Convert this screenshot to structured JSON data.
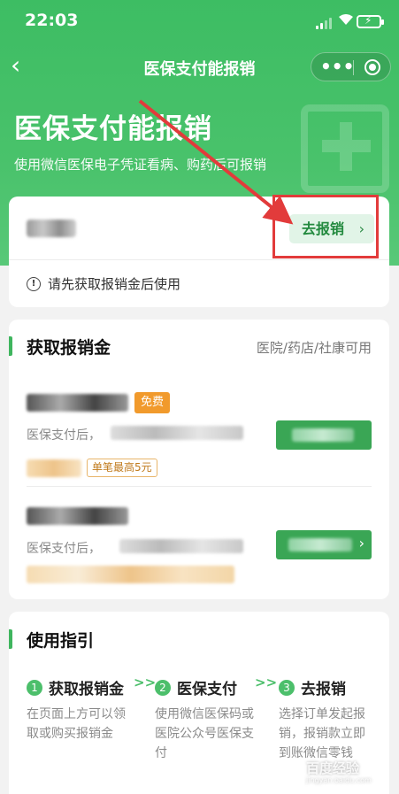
{
  "status_bar": {
    "time": "22:03"
  },
  "nav": {
    "title": "医保支付能报销",
    "more_icon": "•••"
  },
  "hero": {
    "title": "医保支付能报销",
    "subtitle": "使用微信医保电子凭证看病、购药后可报销"
  },
  "claim_card": {
    "button_label": "去报销",
    "notice": "请先获取报销金后使用"
  },
  "get_section": {
    "title": "获取报销金",
    "right_text": "医院/药店/社康可用",
    "items": [
      {
        "badge": "免费",
        "desc_visible": "医保支付后，",
        "limit_tag": "单笔最高5元"
      },
      {
        "desc_visible": "医保支付后，"
      }
    ]
  },
  "guide_section": {
    "title": "使用指引",
    "steps": [
      {
        "num": "1",
        "label": "获取报销金",
        "desc": "在页面上方可以领取或购买报销金"
      },
      {
        "num": "2",
        "label": "医保支付",
        "desc": "使用微信医保码或医院公众号医保支付"
      },
      {
        "num": "3",
        "label": "去报销",
        "desc": "选择订单发起报销，报销款立即到账微信零钱"
      }
    ],
    "arrow": ">>"
  },
  "watermark": {
    "text": "百度经验",
    "url": "jingyan.baidu.com"
  },
  "colors": {
    "brand_green": "#3dbd63",
    "button_green": "#3aa655",
    "annotation_red": "#e23b3b",
    "free_badge": "#f19a2c"
  }
}
